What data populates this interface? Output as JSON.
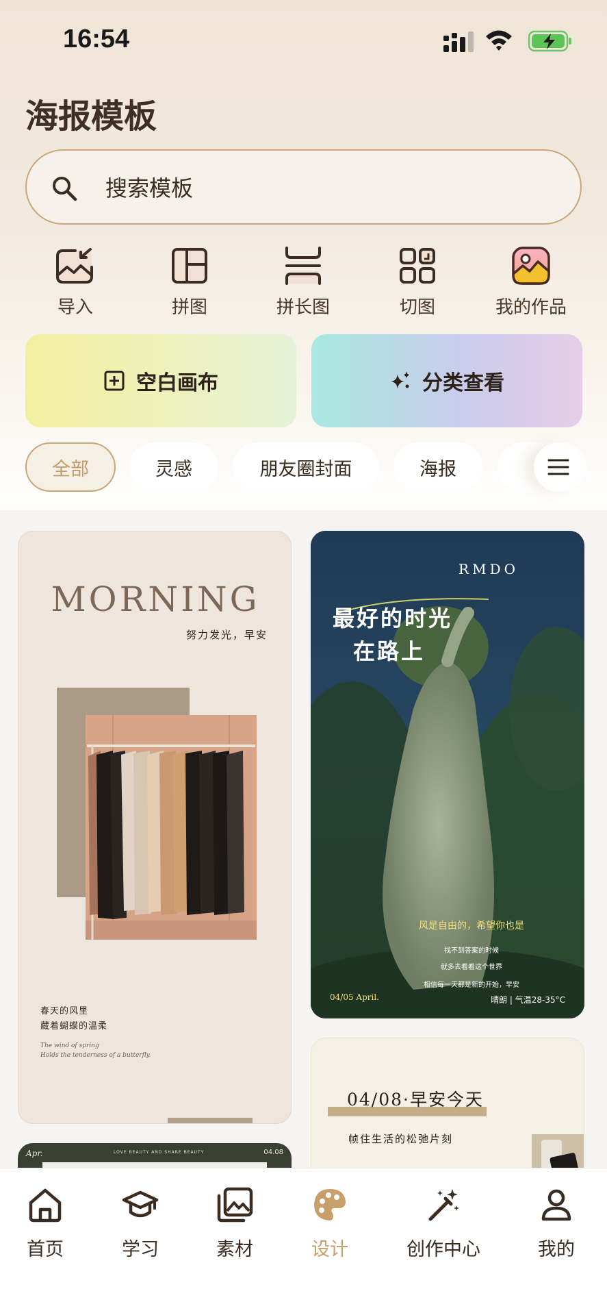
{
  "status_bar": {
    "time": "16:54"
  },
  "page": {
    "title": "海报模板"
  },
  "search": {
    "placeholder": "搜索模板"
  },
  "tools": [
    {
      "label": "导入",
      "icon": "import-image-icon"
    },
    {
      "label": "拼图",
      "icon": "collage-icon"
    },
    {
      "label": "拼长图",
      "icon": "long-collage-icon"
    },
    {
      "label": "切图",
      "icon": "slice-icon"
    },
    {
      "label": "我的作品",
      "icon": "my-works-icon"
    }
  ],
  "actions": {
    "blank_canvas": "空白画布",
    "browse_categories": "分类查看"
  },
  "chips": [
    {
      "label": "全部",
      "active": true
    },
    {
      "label": "灵感",
      "active": false
    },
    {
      "label": "朋友圈封面",
      "active": false
    },
    {
      "label": "海报",
      "active": false
    }
  ],
  "cards": {
    "morning": {
      "title": "MORNING",
      "subtitle": "努力发光，早安",
      "text_cn_1": "春天的风里",
      "text_cn_2": "藏着蝴蝶的温柔",
      "text_en_1": "The wind of spring",
      "text_en_2": "Holds the tenderness of a butterfly."
    },
    "photo": {
      "signature": "RMDO",
      "headline_1": "最好的时光",
      "headline_2": "在路上",
      "yellow_line": "风是自由的，希望你也是",
      "line_1": "找不到答案的时候",
      "line_2": "就多去看看这个世界",
      "line_3": "相信每一天都是新的开始，早安",
      "date": "04/05 April.",
      "weather": "晴朗 | 气温28-35°C"
    },
    "daily": {
      "title": "04/08·早安今天",
      "subtitle": "帧住生活的松弛片刻"
    },
    "april": {
      "left": "Apr.",
      "middle": "LOVE BEAUTY AND SHARE BEAUTY",
      "right": "04.08"
    }
  },
  "tabbar": [
    {
      "label": "首页",
      "icon": "home-icon",
      "active": false
    },
    {
      "label": "学习",
      "icon": "graduation-cap-icon",
      "active": false
    },
    {
      "label": "素材",
      "icon": "gallery-icon",
      "active": false
    },
    {
      "label": "设计",
      "icon": "palette-icon",
      "active": true
    },
    {
      "label": "创作中心",
      "icon": "magic-wand-icon",
      "active": false
    },
    {
      "label": "我的",
      "icon": "user-icon",
      "active": false
    }
  ],
  "colors": {
    "accent": "#c89e6a",
    "border_accent": "#c9a77a",
    "text_dark": "#3e2f22"
  }
}
